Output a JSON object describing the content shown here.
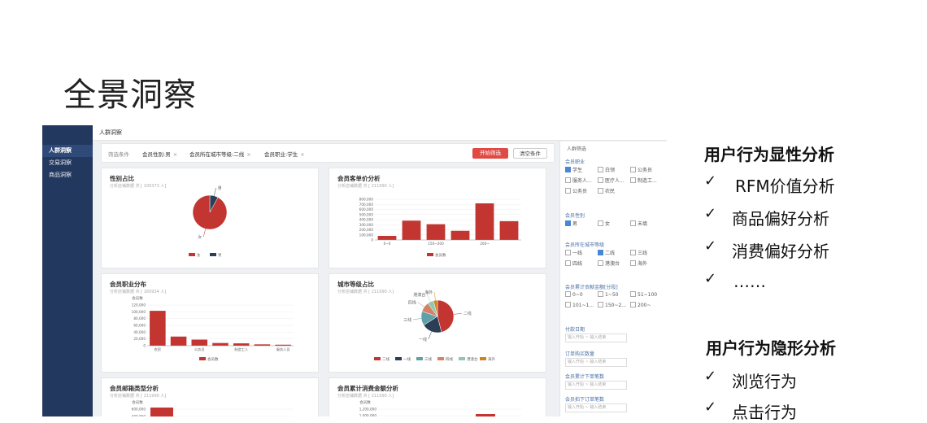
{
  "slide_title": "全景洞察",
  "app": {
    "breadcrumb": "人群洞察",
    "sidebar": [
      "人群洞察",
      "交易洞察",
      "商品洞察"
    ],
    "filter": {
      "label": "筛选条件",
      "tags": [
        "会员性别:男",
        "会员所在城市等级:二线",
        "会员职业:学生"
      ],
      "start_button": "开始筛选",
      "clear_button": "清空条件"
    },
    "cards": [
      {
        "title": "性别占比",
        "sub": "分析店铺数据 共 [ 100373 人]"
      },
      {
        "title": "会员客单价分析",
        "sub": "分析店铺数据 共 [ 211990 人]"
      },
      {
        "title": "会员职业分布",
        "sub": "分析店铺数据 共 [ 160934 人]"
      },
      {
        "title": "城市等级占比",
        "sub": "分析店铺数据 共 [ 211990 人]"
      },
      {
        "title": "会员邮箱类型分析",
        "sub": "分析店铺数据 共 [ 211990 人]"
      },
      {
        "title": "会员累计消费金额分析",
        "sub": "分析店铺数据 共 [ 211990 人]"
      }
    ],
    "right_panel": {
      "head": "人群筛选",
      "job_title": "会员职业",
      "jobs": [
        "学生",
        "白领",
        "公务员",
        "服务人...",
        "医疗人...",
        "制造工...",
        "公务员",
        "农民"
      ],
      "gender_title": "会员性别",
      "genders": [
        "男",
        "女",
        "未填"
      ],
      "city_title": "会员所在城市等级",
      "cities": [
        "一线",
        "二线",
        "三线",
        "四线",
        "港澳台",
        "海外"
      ],
      "amount_title": "会员累计贡献金额[分段]",
      "amounts": [
        "0~0",
        "1~50",
        "51~100",
        "101~1...",
        "150~2...",
        "200~"
      ],
      "pay_title": "付款日期",
      "order_title": "订单购买数量",
      "cum_title": "会员累计下单笔数",
      "pull_title": "会员拍下订单笔数",
      "range_placeholder": "输入开始 ~ 输入结束"
    }
  },
  "chart_data": [
    {
      "type": "pie",
      "title": "性别占比",
      "labels": [
        "男",
        "女"
      ],
      "values": [
        8,
        92
      ],
      "legend": [
        "女",
        "男"
      ],
      "colors": [
        "#2c3e55",
        "#c23531"
      ]
    },
    {
      "type": "bar",
      "title": "会员客单价分析",
      "categories": [
        "0~0",
        "",
        "150~200",
        "",
        "200~",
        ""
      ],
      "values": [
        80000,
        380000,
        310000,
        180000,
        720000,
        370000
      ],
      "yticks": [
        "800,000",
        "700,000",
        "600,000",
        "500,000",
        "400,000",
        "300,000",
        "200,000",
        "100,000",
        "0"
      ],
      "ylim": [
        0,
        800000
      ],
      "legend": "会员数"
    },
    {
      "type": "bar",
      "title": "会员职业分布",
      "categories": [
        "农民",
        "",
        "公务员",
        "",
        "制造工人",
        "",
        "服务人员"
      ],
      "values": [
        103000,
        27000,
        18000,
        8000,
        7000,
        4000,
        3000
      ],
      "yticks": [
        "120,000",
        "100,000",
        "80,000",
        "60,000",
        "40,000",
        "20,000",
        "0"
      ],
      "ylim": [
        0,
        120000
      ],
      "ylabel": "会员数",
      "legend": "会员数"
    },
    {
      "type": "pie",
      "title": "城市等级占比",
      "labels": [
        "二线",
        "一线",
        "三线",
        "四线",
        "港澳台",
        "海外"
      ],
      "values": [
        46,
        20,
        14,
        10,
        6,
        4
      ],
      "legend": [
        "二线",
        "一线",
        "三线",
        "四线",
        "港澳台",
        "海外"
      ],
      "colors": [
        "#c23531",
        "#2c3e55",
        "#61a0a8",
        "#d48265",
        "#91c7ae",
        "#ca8622"
      ]
    },
    {
      "type": "bar",
      "title": "会员邮箱类型分析",
      "yticks": [
        "600,000",
        "400,000"
      ],
      "ylabel": "会员数"
    },
    {
      "type": "bar",
      "title": "会员累计消费金额分析",
      "yticks": [
        "1,200,000",
        "1,000,000"
      ],
      "ylabel": "会员数"
    }
  ],
  "right_text": {
    "heading1": "用户行为显性分析",
    "items1": [
      "RFM价值分析",
      "商品偏好分析",
      "消费偏好分析",
      "……"
    ],
    "heading2": "用户行为隐形分析",
    "items2": [
      "浏览行为",
      "点击行为"
    ],
    "check": "✓"
  }
}
